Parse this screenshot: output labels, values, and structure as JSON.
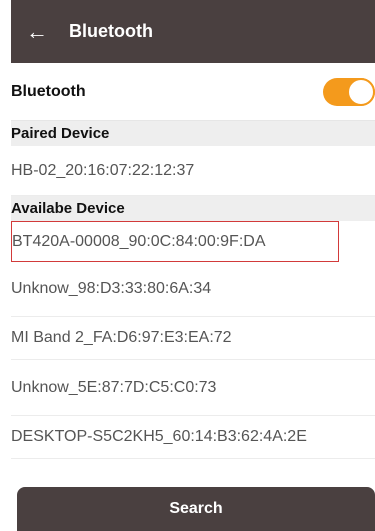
{
  "appbar": {
    "back_icon": "←",
    "title": "Bluetooth"
  },
  "bluetooth_toggle": {
    "label": "Bluetooth",
    "state": "on",
    "color": "#f49a1c"
  },
  "paired": {
    "header": "Paired Device",
    "devices": [
      "HB-02_20:16:07:22:12:37"
    ]
  },
  "available": {
    "header": "Availabe Device",
    "devices": [
      "BT420A-00008_90:0C:84:00:9F:DA",
      "Unknow_98:D3:33:80:6A:34",
      "MI Band 2_FA:D6:97:E3:EA:72",
      "Unknow_5E:87:7D:C5:C0:73",
      "DESKTOP-S5C2KH5_60:14:B3:62:4A:2E"
    ]
  },
  "search_button": {
    "label": "Search"
  },
  "colors": {
    "appbar": "#4a4040",
    "highlight_border": "#d23a3a"
  }
}
